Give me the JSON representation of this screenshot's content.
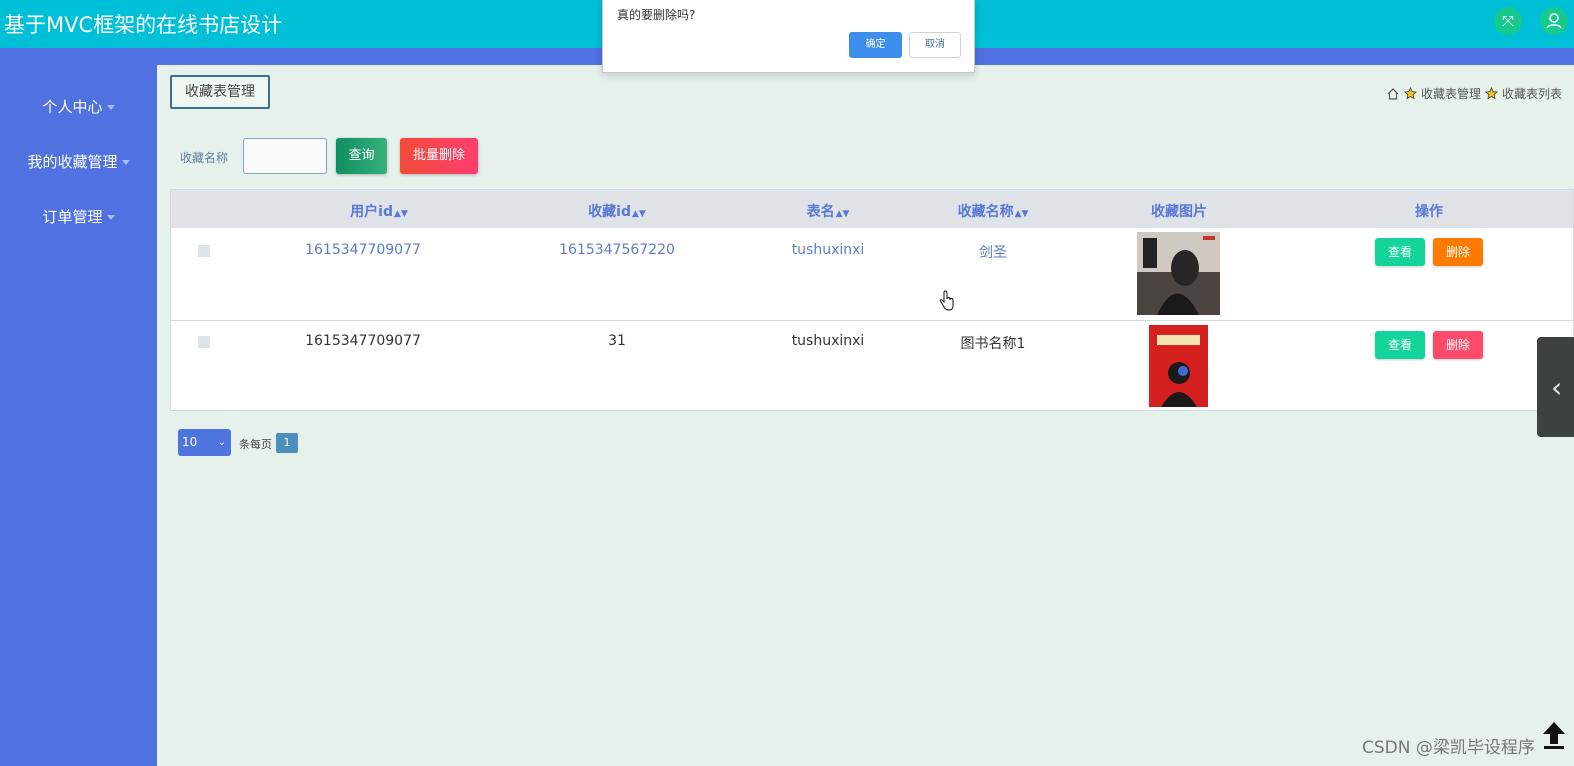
{
  "header": {
    "title": "基于MVC框架的在线书店设计",
    "fullscreen_icon": "expand-icon",
    "user_icon": "user-icon"
  },
  "sidebar": {
    "items": [
      {
        "label": "个人中心"
      },
      {
        "label": "我的收藏管理"
      },
      {
        "label": "订单管理"
      }
    ]
  },
  "page": {
    "title": "收藏表管理"
  },
  "breadcrumb": {
    "items": [
      "收藏表管理",
      "收藏表列表"
    ]
  },
  "search": {
    "label": "收藏名称",
    "value": "",
    "query_button": "查询",
    "batch_delete_button": "批量删除"
  },
  "table": {
    "columns": [
      "用户id",
      "收藏id",
      "表名",
      "收藏名称",
      "收藏图片",
      "操作"
    ],
    "rows": [
      {
        "user_id": "1615347709077",
        "fav_id": "1615347567220",
        "table_name": "tushuxinxi",
        "fav_name": "剑圣",
        "view": "查看",
        "delete": "删除"
      },
      {
        "user_id": "1615347709077",
        "fav_id": "31",
        "table_name": "tushuxinxi",
        "fav_name": "图书名称1",
        "view": "查看",
        "delete": "删除"
      }
    ]
  },
  "pagination": {
    "page_size": "10",
    "per_page_label": "条每页",
    "current_page": "1"
  },
  "dialog": {
    "message": "真的要删除吗?",
    "ok": "确定",
    "cancel": "取消"
  },
  "watermark": "CSDN @梁凯毕设程序",
  "colors": {
    "topbar": "#00c0d8",
    "sidebar": "#4f72e0",
    "view": "#13d49b",
    "delete_orange": "#ff7a00",
    "delete_pink": "#ff4a6b"
  }
}
